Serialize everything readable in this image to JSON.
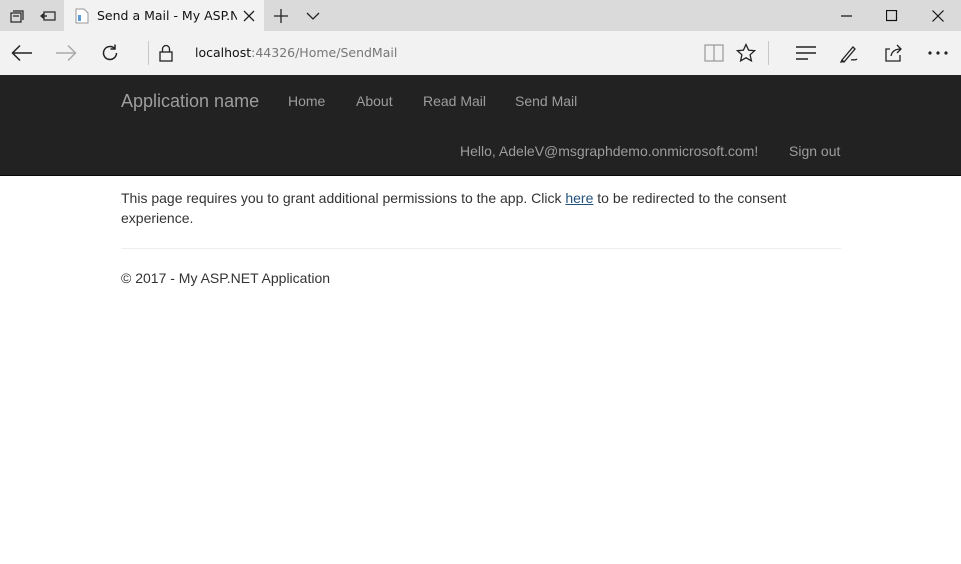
{
  "browser": {
    "tab": {
      "title": "Send a Mail - My ASP.N"
    },
    "address": {
      "host": "localhost",
      "rest": ":44326/Home/SendMail"
    },
    "icons": {
      "tab_actions": "tab-actions-icon",
      "set_aside": "set-tabs-aside-icon",
      "favicon": "page-favicon-icon",
      "close_tab": "close-icon",
      "new_tab": "plus-icon",
      "tab_menu": "chevron-down-icon",
      "minimize": "minimize-icon",
      "maximize": "maximize-icon",
      "close_window": "close-icon",
      "back": "back-arrow-icon",
      "forward": "forward-arrow-icon",
      "refresh": "refresh-icon",
      "lock": "lock-icon",
      "reading_view": "reading-view-icon",
      "favorite": "star-icon",
      "hub": "hub-icon",
      "notes": "pen-icon",
      "share": "share-icon",
      "more": "more-icon"
    }
  },
  "navbar": {
    "brand": "Application name",
    "links": [
      "Home",
      "About",
      "Read Mail",
      "Send Mail"
    ],
    "greeting": "Hello, AdeleV@msgraphdemo.onmicrosoft.com!",
    "signout": "Sign out",
    "colors": {
      "background": "#222222",
      "link": "#9d9d9d"
    }
  },
  "main": {
    "message_before": "This page requires you to grant additional permissions to the app. Click ",
    "link_text": "here",
    "message_after": " to be redirected to the consent experience."
  },
  "footer": {
    "text": "© 2017 - My ASP.NET Application"
  }
}
